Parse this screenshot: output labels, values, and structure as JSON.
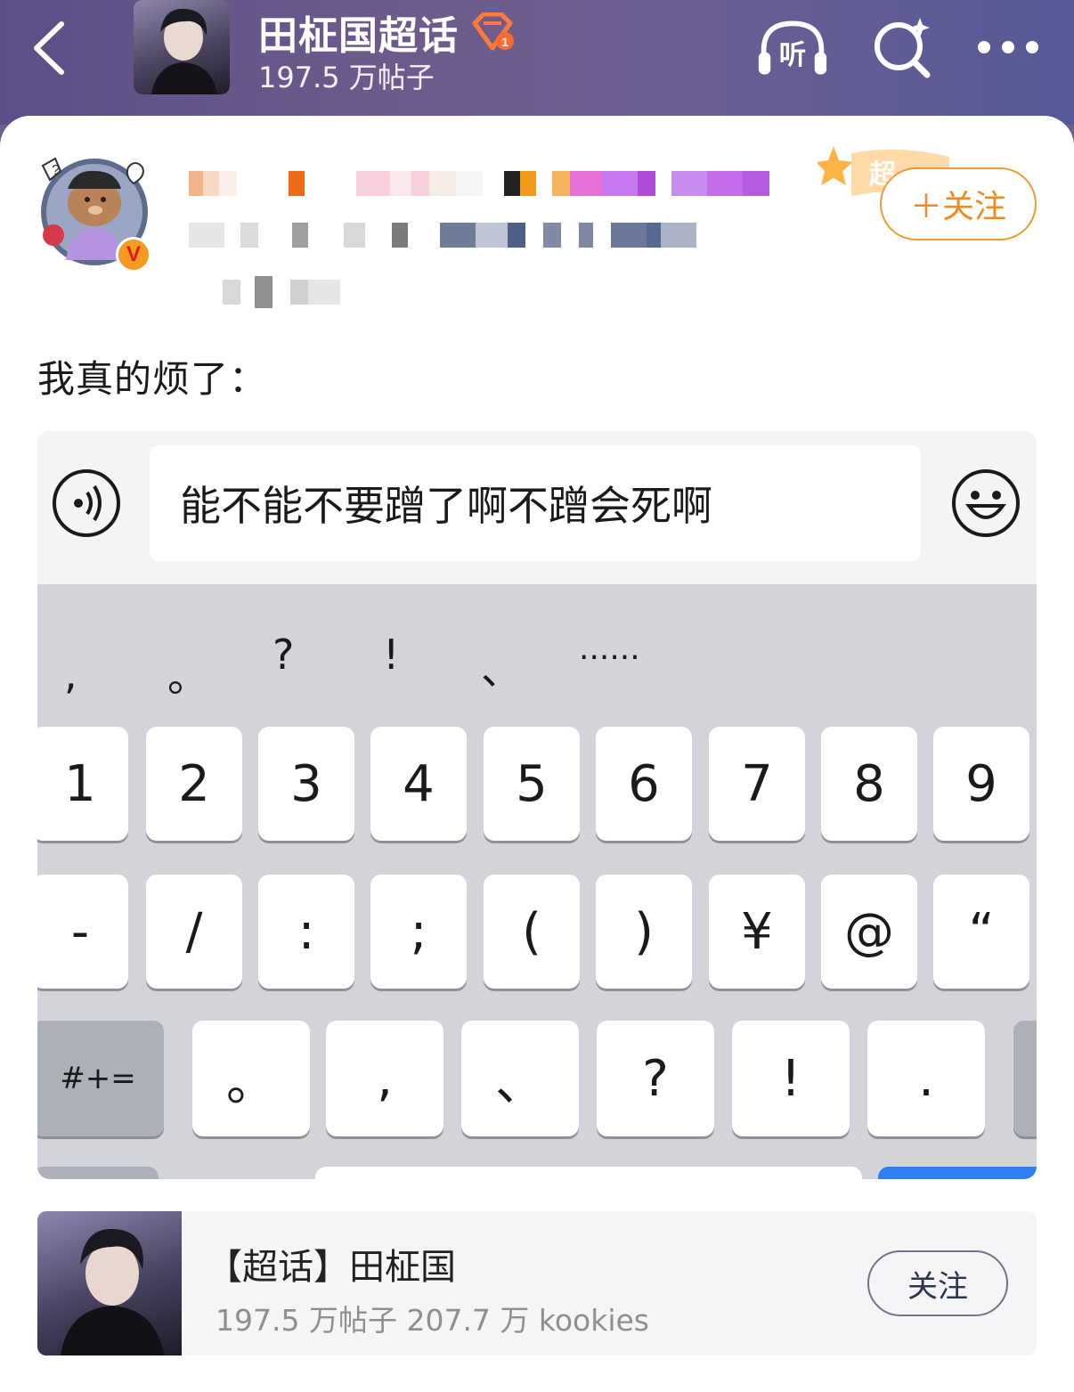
{
  "header": {
    "title": "田柾国超话",
    "subtitle": "197.5 万帖子",
    "listen_label": "听",
    "back_icon": "chevron-left-icon",
    "search_icon": "search-sparkle-icon",
    "more_icon": "more-dots-icon"
  },
  "post": {
    "follow_label": "＋关注",
    "follow_badge_text": "超",
    "text": "我真的烦了：",
    "author_verified_label": "V"
  },
  "screenshot": {
    "input_text": "能不能不要蹭了啊不蹭会死啊",
    "punctuation": [
      ",",
      "。",
      "?",
      "!",
      "、",
      "......"
    ],
    "row_numbers": [
      "1",
      "2",
      "3",
      "4",
      "5",
      "6",
      "7",
      "8",
      "9"
    ],
    "row_symbols": [
      "-",
      "/",
      ":",
      ";",
      "(",
      ")",
      "¥",
      "@",
      "“"
    ],
    "row_third_mode": "#+=",
    "row_third": [
      "。",
      ",",
      "、",
      "?",
      "!",
      "."
    ]
  },
  "topic_card": {
    "title": "【超话】田柾国",
    "stats": "197.5 万帖子 207.7 万 kookies",
    "follow_label": "关注"
  },
  "colors": {
    "accent_orange": "#f08a1e",
    "header_purple": "#6c5a8b"
  }
}
